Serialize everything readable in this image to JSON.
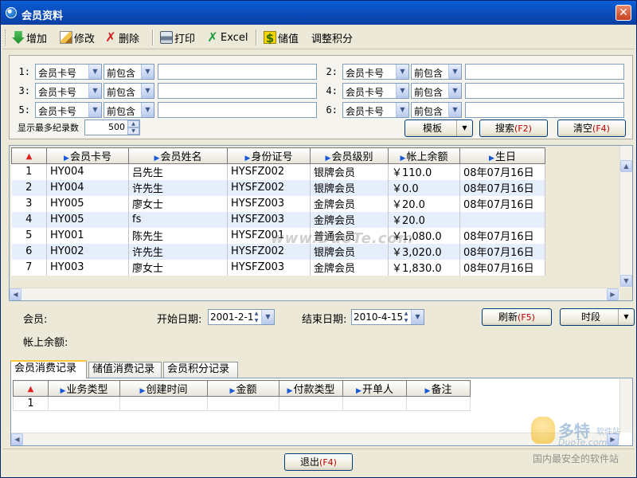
{
  "window": {
    "title": "会员资料",
    "close": "✕"
  },
  "toolbar": {
    "add": "增加",
    "edit": "修改",
    "delete": "删除",
    "print": "打印",
    "excel": "Excel",
    "recharge": "储值",
    "adjust_points": "调整积分"
  },
  "filters": {
    "rows": [
      {
        "num": "1:",
        "field": "会员卡号",
        "op": "前包含",
        "value": ""
      },
      {
        "num": "2:",
        "field": "会员卡号",
        "op": "前包含",
        "value": ""
      },
      {
        "num": "3:",
        "field": "会员卡号",
        "op": "前包含",
        "value": ""
      },
      {
        "num": "4:",
        "field": "会员卡号",
        "op": "前包含",
        "value": ""
      },
      {
        "num": "5:",
        "field": "会员卡号",
        "op": "前包含",
        "value": ""
      },
      {
        "num": "6:",
        "field": "会员卡号",
        "op": "前包含",
        "value": ""
      }
    ],
    "max_records_label": "显示最多纪录数",
    "max_records": "500",
    "template_btn": "模板",
    "search_btn": "搜索",
    "search_key": "(F2)",
    "clear_btn": "清空",
    "clear_key": "(F4)"
  },
  "grid": {
    "rn_header": "▲",
    "columns": [
      "会员卡号",
      "会员姓名",
      "身份证号",
      "会员级别",
      "帐上余额",
      "生日"
    ],
    "rows": [
      [
        "1",
        "HY004",
        "吕先生",
        "HYSFZ002",
        "银牌会员",
        "￥110.0",
        "08年07月16日"
      ],
      [
        "2",
        "HY004",
        "许先生",
        "HYSFZ002",
        "银牌会员",
        "￥0.0",
        "08年07月16日"
      ],
      [
        "3",
        "HY005",
        "廖女士",
        "HYSFZ003",
        "金牌会员",
        "￥20.0",
        "08年07月16日"
      ],
      [
        "4",
        "HY005",
        "fs",
        "HYSFZ003",
        "金牌会员",
        "￥20.0",
        ""
      ],
      [
        "5",
        "HY001",
        "陈先生",
        "HYSFZ001",
        "普通会员",
        "￥1,080.0",
        "08年07月16日"
      ],
      [
        "6",
        "HY002",
        "许先生",
        "HYSFZ002",
        "银牌会员",
        "￥3,020.0",
        "08年07月16日"
      ],
      [
        "7",
        "HY003",
        "廖女士",
        "HYSFZ003",
        "金牌会员",
        "￥1,830.0",
        "08年07月16日"
      ]
    ]
  },
  "details": {
    "member_label": "会员:",
    "start_label": "开始日期:",
    "start_date": "2001-2-1",
    "end_label": "结束日期:",
    "end_date": "2010-4-15",
    "refresh_btn": "刷新",
    "refresh_key": "(F5)",
    "period_btn": "时段",
    "balance_label": "帐上余额:"
  },
  "tabs": [
    "会员消费记录",
    "储值消费记录",
    "会员积分记录"
  ],
  "subgrid": {
    "columns": [
      "业务类型",
      "创建时间",
      "金额",
      "付款类型",
      "开单人",
      "备注"
    ],
    "rows": [
      [
        "1",
        "",
        "",
        "",
        "",
        "",
        ""
      ]
    ]
  },
  "footer": {
    "exit_btn": "退出",
    "exit_key": "(F4)"
  },
  "watermarks": {
    "center": "www.DuoTe.com",
    "brand": "多特",
    "brand_suffix": "软件站",
    "brand_en": "DuoTe.com",
    "slogan": "国内最安全的软件站"
  },
  "colors": {
    "title_bar": "#0a4fc0",
    "hotkey": "#bb0000",
    "alt_row": "#e6eefb",
    "header_arrow": "#1659d8"
  },
  "icons": {
    "app": "app-icon",
    "add": "green-down-arrow-icon",
    "edit": "pencil-icon",
    "delete": "red-x-icon",
    "print": "printer-icon",
    "excel": "green-x-icon",
    "recharge": "dollar-icon"
  }
}
